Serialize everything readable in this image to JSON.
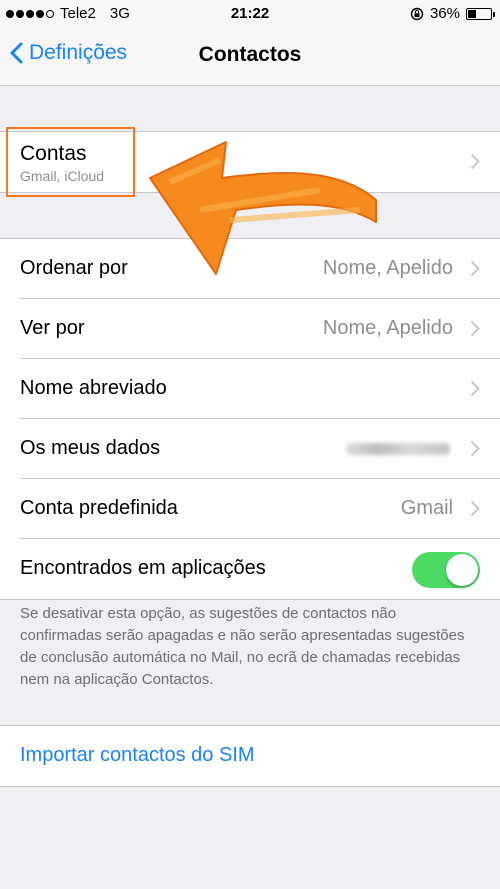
{
  "status_bar": {
    "carrier": "Tele2",
    "network": "3G",
    "time": "21:22",
    "battery_percent": "36%",
    "battery_level": 0.36,
    "signal_bars": 4
  },
  "nav": {
    "back_label": "Definições",
    "title": "Contactos"
  },
  "accounts": {
    "label": "Contas",
    "subtitle": "Gmail, iCloud"
  },
  "settings": {
    "sort_order": {
      "label": "Ordenar por",
      "value": "Nome, Apelido"
    },
    "display_order": {
      "label": "Ver por",
      "value": "Nome, Apelido"
    },
    "short_name": {
      "label": "Nome abreviado"
    },
    "my_info": {
      "label": "Os meus dados"
    },
    "default_account": {
      "label": "Conta predefinida",
      "value": "Gmail"
    },
    "found_in_apps": {
      "label": "Encontrados em aplicações",
      "enabled": true
    }
  },
  "footnote": "Se desativar esta opção, as sugestões de contactos não confirmadas serão apagadas e não serão apresentadas sugestões de conclusão automática no Mail, no ecrã de chamadas recebidas nem na aplicação Contactos.",
  "import": {
    "label": "Importar contactos do SIM"
  },
  "colors": {
    "accent": "#1a82fb",
    "toggle_on": "#4cd964",
    "highlight": "#f07a24"
  }
}
